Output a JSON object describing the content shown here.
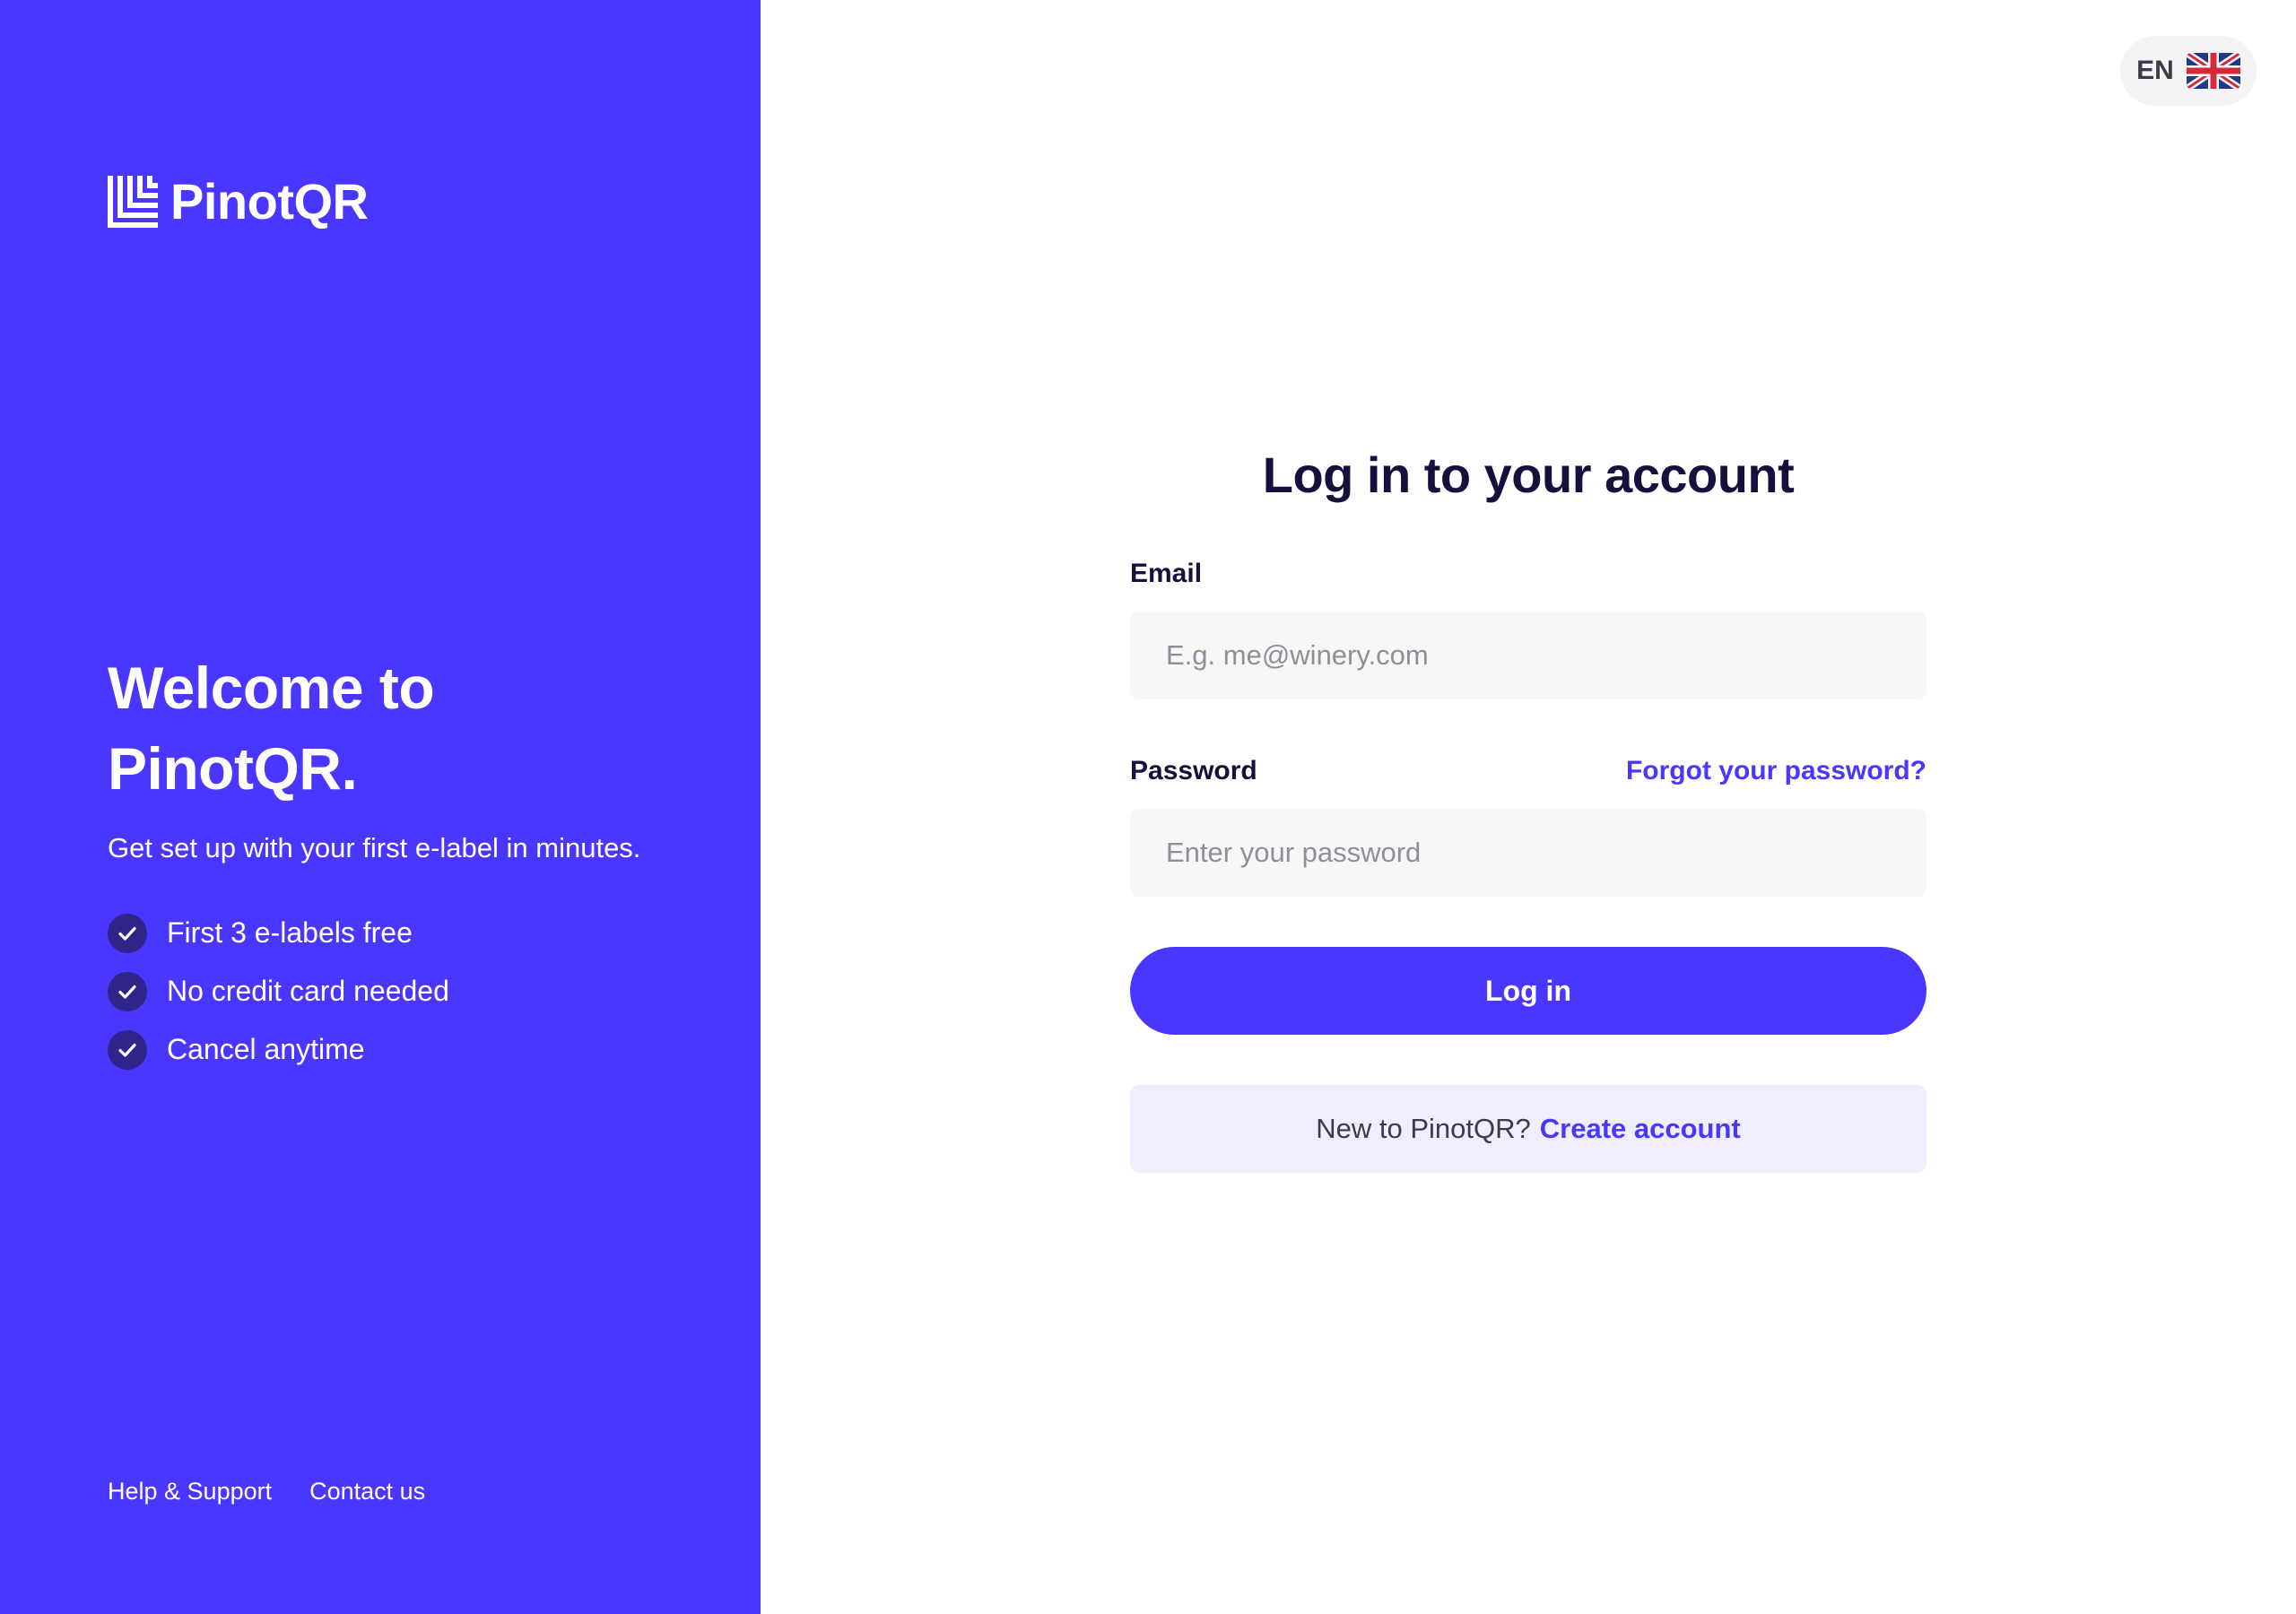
{
  "brand": {
    "name": "PinotQR",
    "primary_color": "#4937ff",
    "text_dark": "#14123d"
  },
  "left_panel": {
    "welcome_title_line1": "Welcome to",
    "welcome_title_line2": "PinotQR.",
    "subtitle": "Get set up with your first e-label in minutes.",
    "features": [
      {
        "label": "First 3 e-labels free",
        "icon": "check-icon"
      },
      {
        "label": "No credit card needed",
        "icon": "check-icon"
      },
      {
        "label": "Cancel anytime",
        "icon": "check-icon"
      }
    ],
    "footer_links": [
      "Help & Support",
      "Contact us"
    ]
  },
  "language": {
    "code": "EN",
    "flag_icon": "uk-flag-icon"
  },
  "login_form": {
    "title": "Log in to your account",
    "email_label": "Email",
    "email_placeholder": "E.g. me@winery.com",
    "email_value": "",
    "password_label": "Password",
    "forgot_password": "Forgot your password?",
    "password_placeholder": "Enter your password",
    "password_value": "",
    "submit_label": "Log in",
    "signup_prompt": "New to PinotQR?",
    "signup_link": "Create account"
  }
}
